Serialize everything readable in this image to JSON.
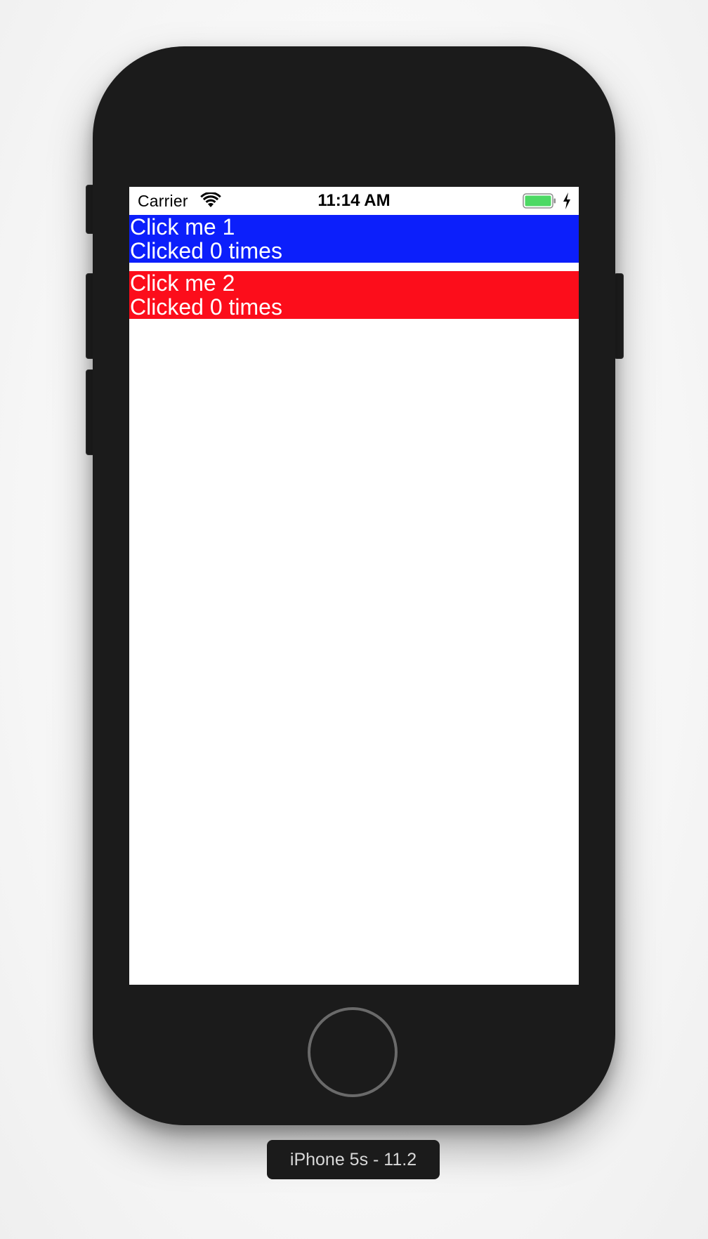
{
  "status_bar": {
    "carrier": "Carrier",
    "time": "11:14 AM",
    "wifi_icon": "wifi-icon",
    "battery_icon": "battery-icon",
    "charging_icon": "charging-bolt-icon",
    "battery_level": 1.0,
    "battery_color": "#4cd964"
  },
  "rows": [
    {
      "title": "Click me 1",
      "count_text": "Clicked 0 times",
      "color": "#0c1ffb"
    },
    {
      "title": "Click me 2",
      "count_text": "Clicked 0 times",
      "color": "#fc0d1b"
    }
  ],
  "device": {
    "label": "iPhone 5s - 11.2"
  }
}
